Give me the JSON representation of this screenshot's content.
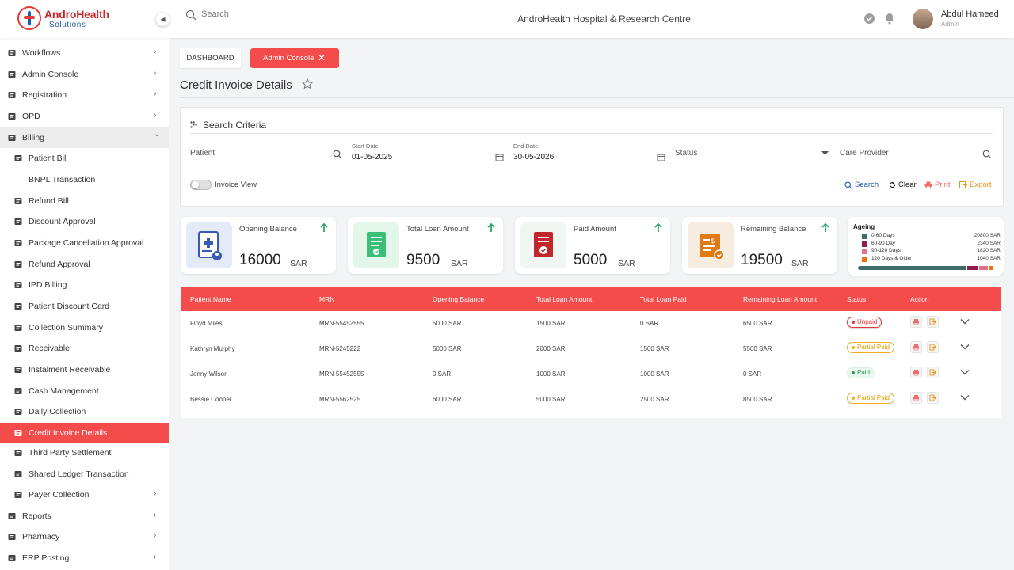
{
  "app": {
    "logo_title": "AndroHealth",
    "logo_subtitle": "Solutions",
    "hospital_name": "AndroHealth Hospital & Research Centre"
  },
  "search": {
    "placeholder": "Search"
  },
  "user": {
    "name": "Abdul Hameed",
    "role": "Admin"
  },
  "sidebar": {
    "items": [
      {
        "label": "Workflows",
        "icon": "laptop-icon"
      },
      {
        "label": "Admin Console",
        "icon": "gear-icon"
      },
      {
        "label": "Registration",
        "icon": "check-square-icon"
      },
      {
        "label": "OPD",
        "icon": "building-icon"
      },
      {
        "label": "Billing",
        "icon": "wallet-icon"
      },
      {
        "label": "Patient Bill",
        "icon": "bill-icon"
      },
      {
        "label": "BNPL Transaction",
        "icon": ""
      },
      {
        "label": "Refund Bill",
        "icon": "refund-icon"
      },
      {
        "label": "Discount Approval",
        "icon": "discount-doc-icon"
      },
      {
        "label": "Package Cancellation Approval",
        "icon": "package-icon"
      },
      {
        "label": "Refund Approval",
        "icon": "refund-approval-icon"
      },
      {
        "label": "IPD Billing",
        "icon": "ipd-icon"
      },
      {
        "label": "Patient Discount Card",
        "icon": "card-icon"
      },
      {
        "label": "Collection Summary",
        "icon": "collection-icon"
      },
      {
        "label": "Receivable",
        "icon": "receivable-icon"
      },
      {
        "label": "Instalment Receivable",
        "icon": "instalment-icon"
      },
      {
        "label": "Cash Management",
        "icon": "cash-icon"
      },
      {
        "label": "Daily Collection",
        "icon": "daily-icon"
      },
      {
        "label": "Credit Invoice Details",
        "icon": "credit-icon"
      },
      {
        "label": "Third Party Settlement",
        "icon": "settlement-icon"
      },
      {
        "label": "Shared Ledger Transaction",
        "icon": "ledger-icon"
      },
      {
        "label": "Payer Collection",
        "icon": "payer-icon"
      },
      {
        "label": "Reports",
        "icon": "report-icon"
      },
      {
        "label": "Pharmacy",
        "icon": "pharmacy-icon"
      },
      {
        "label": "ERP Posting",
        "icon": "erp-icon"
      }
    ]
  },
  "breadcrumb": {
    "home": "DASHBOARD",
    "current": "Admin Console",
    "close": "✕"
  },
  "page": {
    "title": "Credit Invoice Details"
  },
  "criteria": {
    "title": "Search Criteria",
    "patient_placeholder": "Patient",
    "start_label": "Start Date",
    "start_value": "01-05-2025",
    "end_label": "End Date",
    "end_value": "30-05-2026",
    "status_placeholder": "Status",
    "provider_placeholder": "Care Provider",
    "invoice_view": "Invoice View",
    "search_btn": "Search",
    "clear_btn": "Clear",
    "print_btn": "Print",
    "export_btn": "Export"
  },
  "cards": [
    {
      "label": "Opening Balance",
      "value": "16000",
      "currency": "SAR"
    },
    {
      "label": "Total Loan Amount",
      "value": "9500",
      "currency": "SAR"
    },
    {
      "label": "Paid Amount",
      "value": "5000",
      "currency": "SAR"
    },
    {
      "label": "Remaining Balance",
      "value": "19500",
      "currency": "SAR"
    }
  ],
  "ageing": {
    "title": "Ageing",
    "rows": [
      {
        "label": "0-60 Days",
        "value": "20800 SAR",
        "amount": 20800,
        "color": "#3f6e6a"
      },
      {
        "label": "60-90 Day",
        "value": "2340 SAR",
        "amount": 2340,
        "color": "#8b1f4e"
      },
      {
        "label": "90-120 Days",
        "value": "1820 SAR",
        "amount": 1820,
        "color": "#e07389"
      },
      {
        "label": "120 Days & Older",
        "value": "1040 SAR",
        "amount": 1040,
        "color": "#e8731a"
      }
    ]
  },
  "table": {
    "headers": [
      "Patient  Name",
      "MRN",
      "Opening Balance",
      "Total Loan Amount",
      "Total Loan Paid",
      "Remaining Loan Amount",
      "Status",
      "Action"
    ],
    "rows": [
      {
        "name": "Floyd Miles",
        "mrn": "MRN-55452555",
        "opening": "5000 SAR",
        "loan": "1500 SAR",
        "paid": "0 SAR",
        "remaining": "6500 SAR",
        "status": "Unpaid",
        "status_type": "unpaid"
      },
      {
        "name": "Kathryn Murphy",
        "mrn": "MRN-5245222",
        "opening": "5000 SAR",
        "loan": "2000 SAR",
        "paid": "1500 SAR",
        "remaining": "5500 SAR",
        "status": "Partial Paid",
        "status_type": "partial"
      },
      {
        "name": "Jenny Wilson",
        "mrn": "MRN-55452555",
        "opening": "0  SAR",
        "loan": "1000  SAR",
        "paid": "1000  SAR",
        "remaining": "0  SAR",
        "status": "Paid",
        "status_type": "paid"
      },
      {
        "name": "Bessie Cooper",
        "mrn": "MRN-5562525",
        "opening": "6000 SAR",
        "loan": "5000 SAR",
        "paid": "2500 SAR",
        "remaining": "8500 SAR",
        "status": "Partial Paid",
        "status_type": "partial"
      }
    ]
  },
  "colors": {
    "accent": "#f44b4b",
    "link": "#1e5aa8",
    "print": "#f06b6b",
    "export": "#e8931a"
  }
}
